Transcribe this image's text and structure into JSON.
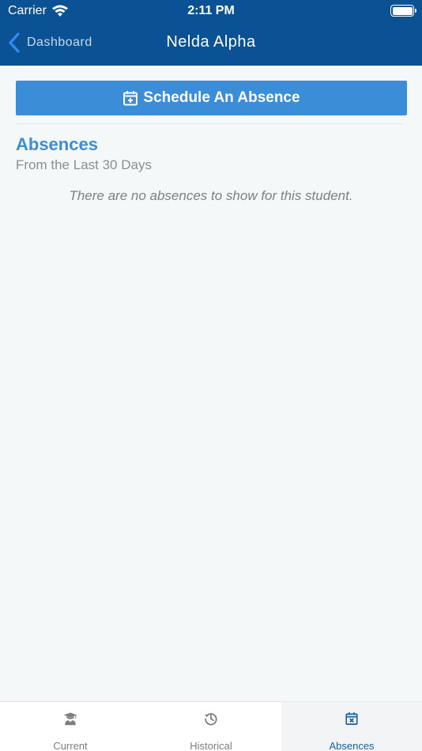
{
  "status_bar": {
    "carrier": "Carrier",
    "time": "2:11 PM"
  },
  "nav": {
    "back_label": "Dashboard",
    "title": "Nelda Alpha"
  },
  "main": {
    "schedule_button_label": "Schedule An Absence",
    "section_title": "Absences",
    "section_subtitle": "From the Last 30 Days",
    "empty_message": "There are no absences to show for this student."
  },
  "tabs": [
    {
      "label": "Current",
      "icon": "graduate-icon",
      "active": false
    },
    {
      "label": "Historical",
      "icon": "history-icon",
      "active": false
    },
    {
      "label": "Absences",
      "icon": "calendar-x-icon",
      "active": true
    }
  ],
  "colors": {
    "header_bg": "#0a5294",
    "accent": "#3b8dd8",
    "active_tab_label": "#1a5fa3",
    "page_bg": "#f4f8f9"
  }
}
